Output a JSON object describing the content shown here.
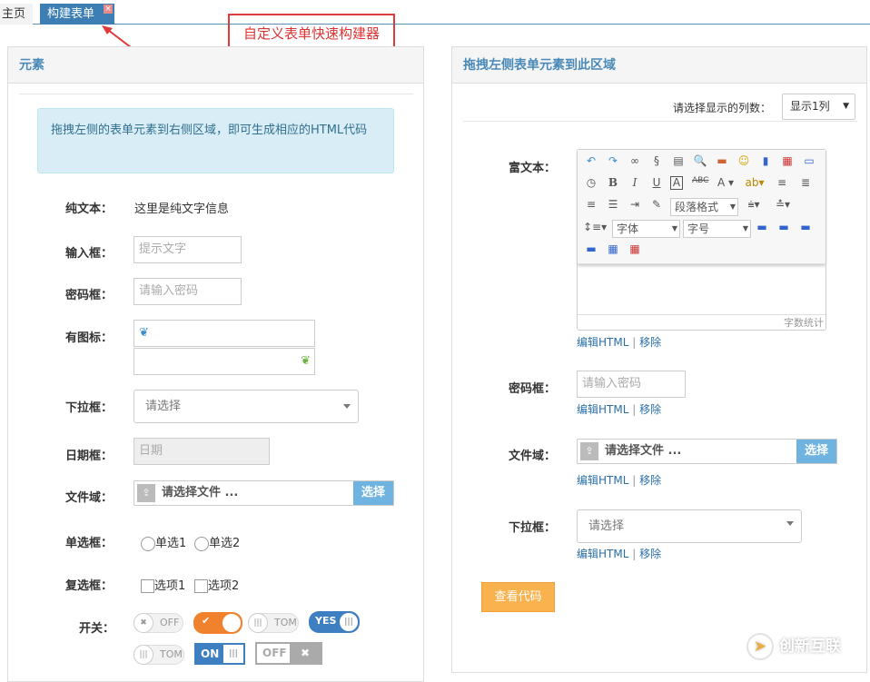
{
  "tabs": [
    {
      "label": "主页"
    },
    {
      "label": "构建表单",
      "close": "×"
    }
  ],
  "annotation": "自定义表单快速构建器",
  "left_panel": {
    "title": "元素",
    "info": "拖拽左侧的表单元素到右侧区域，即可生成相应的HTML代码",
    "fields": {
      "plain_label": "纯文本：",
      "plain_text": "这里是纯文字信息",
      "input_label": "输入框：",
      "input_placeholder": "提示文字",
      "password_label": "密码框：",
      "password_placeholder": "请输入密码",
      "icon_label": "有图标：",
      "select_label": "下拉框：",
      "select_value": "请选择",
      "date_label": "日期框：",
      "date_placeholder": "日期",
      "file_label": "文件域：",
      "file_text": "请选择文件 ...",
      "file_button": "选择",
      "radio_label": "单选框：",
      "radio1": "单选1",
      "radio2": "单选2",
      "checkbox_label": "复选框：",
      "check1": "选项1",
      "check2": "选项2",
      "switch_label": "开关："
    },
    "switches": {
      "off": "OFF",
      "tom": "TOM",
      "yes": "YES",
      "on": "ON",
      "off2": "OFF"
    }
  },
  "right_panel": {
    "title": "拖拽左侧表单元素到此区域",
    "columns_label": "请选择显示的列数：",
    "columns_value": "显示1列",
    "richtext_label": "富文本：",
    "editor": {
      "paragraph": "段落格式",
      "font": "字体",
      "size": "字号",
      "wordcount": "字数统计"
    },
    "edit_link": "编辑HTML",
    "sep": "|",
    "remove_link": "移除",
    "password_label": "密码框：",
    "password_placeholder": "请输入密码",
    "file_label": "文件域：",
    "file_text": "请选择文件 ...",
    "file_button": "选择",
    "select_label": "下拉框：",
    "select_value": "请选择",
    "view_code": "查看代码"
  },
  "watermark": "创新互联"
}
